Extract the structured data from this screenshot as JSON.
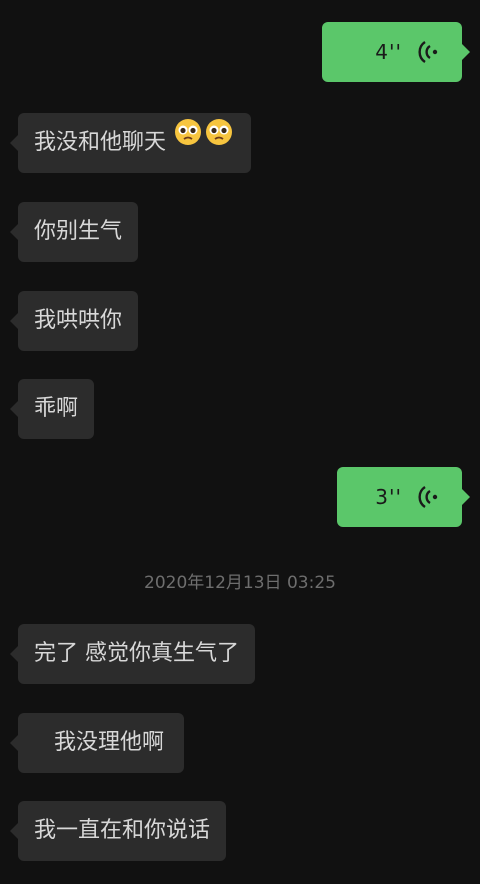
{
  "messages": [
    {
      "side": "out",
      "type": "voice",
      "duration": "4''"
    },
    {
      "side": "in",
      "text": "我没和他聊天",
      "emoji": [
        "pleading-face",
        "pleading-face"
      ]
    },
    {
      "side": "in",
      "text": "你别生气"
    },
    {
      "side": "in",
      "text": "我哄哄你"
    },
    {
      "side": "in",
      "text": "乖啊"
    },
    {
      "side": "out",
      "type": "voice",
      "duration": "3''"
    },
    {
      "side": "in",
      "text": "完了 感觉你真生气了"
    },
    {
      "side": "in",
      "text": "我没理他啊"
    },
    {
      "side": "in",
      "text": "我一直在和你说话"
    }
  ],
  "timestamp": "2020年12月13日 03:25",
  "colors": {
    "background": "#111111",
    "incoming_bubble": "#2c2c2c",
    "outgoing_bubble": "#5bc76a",
    "timestamp_text": "#6e6e6e"
  }
}
